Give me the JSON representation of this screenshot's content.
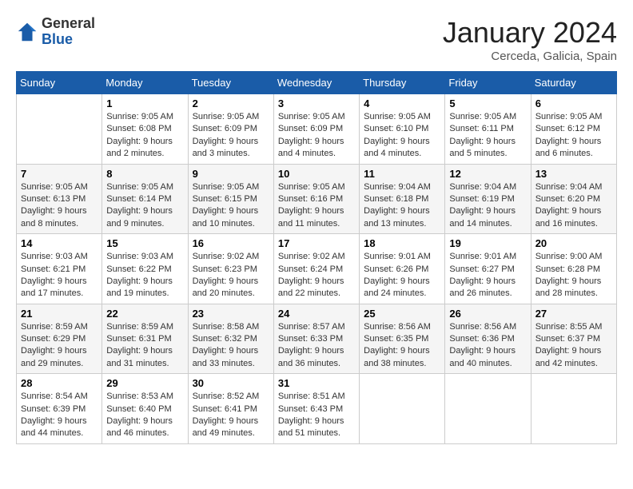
{
  "header": {
    "logo": {
      "general": "General",
      "blue": "Blue"
    },
    "title": "January 2024",
    "location": "Cerceda, Galicia, Spain"
  },
  "calendar": {
    "days_of_week": [
      "Sunday",
      "Monday",
      "Tuesday",
      "Wednesday",
      "Thursday",
      "Friday",
      "Saturday"
    ],
    "weeks": [
      [
        {
          "day": null,
          "info": null
        },
        {
          "day": "1",
          "info": "Sunrise: 9:05 AM\nSunset: 6:08 PM\nDaylight: 9 hours\nand 2 minutes."
        },
        {
          "day": "2",
          "info": "Sunrise: 9:05 AM\nSunset: 6:09 PM\nDaylight: 9 hours\nand 3 minutes."
        },
        {
          "day": "3",
          "info": "Sunrise: 9:05 AM\nSunset: 6:09 PM\nDaylight: 9 hours\nand 4 minutes."
        },
        {
          "day": "4",
          "info": "Sunrise: 9:05 AM\nSunset: 6:10 PM\nDaylight: 9 hours\nand 4 minutes."
        },
        {
          "day": "5",
          "info": "Sunrise: 9:05 AM\nSunset: 6:11 PM\nDaylight: 9 hours\nand 5 minutes."
        },
        {
          "day": "6",
          "info": "Sunrise: 9:05 AM\nSunset: 6:12 PM\nDaylight: 9 hours\nand 6 minutes."
        }
      ],
      [
        {
          "day": "7",
          "info": "Sunrise: 9:05 AM\nSunset: 6:13 PM\nDaylight: 9 hours\nand 8 minutes."
        },
        {
          "day": "8",
          "info": "Sunrise: 9:05 AM\nSunset: 6:14 PM\nDaylight: 9 hours\nand 9 minutes."
        },
        {
          "day": "9",
          "info": "Sunrise: 9:05 AM\nSunset: 6:15 PM\nDaylight: 9 hours\nand 10 minutes."
        },
        {
          "day": "10",
          "info": "Sunrise: 9:05 AM\nSunset: 6:16 PM\nDaylight: 9 hours\nand 11 minutes."
        },
        {
          "day": "11",
          "info": "Sunrise: 9:04 AM\nSunset: 6:18 PM\nDaylight: 9 hours\nand 13 minutes."
        },
        {
          "day": "12",
          "info": "Sunrise: 9:04 AM\nSunset: 6:19 PM\nDaylight: 9 hours\nand 14 minutes."
        },
        {
          "day": "13",
          "info": "Sunrise: 9:04 AM\nSunset: 6:20 PM\nDaylight: 9 hours\nand 16 minutes."
        }
      ],
      [
        {
          "day": "14",
          "info": "Sunrise: 9:03 AM\nSunset: 6:21 PM\nDaylight: 9 hours\nand 17 minutes."
        },
        {
          "day": "15",
          "info": "Sunrise: 9:03 AM\nSunset: 6:22 PM\nDaylight: 9 hours\nand 19 minutes."
        },
        {
          "day": "16",
          "info": "Sunrise: 9:02 AM\nSunset: 6:23 PM\nDaylight: 9 hours\nand 20 minutes."
        },
        {
          "day": "17",
          "info": "Sunrise: 9:02 AM\nSunset: 6:24 PM\nDaylight: 9 hours\nand 22 minutes."
        },
        {
          "day": "18",
          "info": "Sunrise: 9:01 AM\nSunset: 6:26 PM\nDaylight: 9 hours\nand 24 minutes."
        },
        {
          "day": "19",
          "info": "Sunrise: 9:01 AM\nSunset: 6:27 PM\nDaylight: 9 hours\nand 26 minutes."
        },
        {
          "day": "20",
          "info": "Sunrise: 9:00 AM\nSunset: 6:28 PM\nDaylight: 9 hours\nand 28 minutes."
        }
      ],
      [
        {
          "day": "21",
          "info": "Sunrise: 8:59 AM\nSunset: 6:29 PM\nDaylight: 9 hours\nand 29 minutes."
        },
        {
          "day": "22",
          "info": "Sunrise: 8:59 AM\nSunset: 6:31 PM\nDaylight: 9 hours\nand 31 minutes."
        },
        {
          "day": "23",
          "info": "Sunrise: 8:58 AM\nSunset: 6:32 PM\nDaylight: 9 hours\nand 33 minutes."
        },
        {
          "day": "24",
          "info": "Sunrise: 8:57 AM\nSunset: 6:33 PM\nDaylight: 9 hours\nand 36 minutes."
        },
        {
          "day": "25",
          "info": "Sunrise: 8:56 AM\nSunset: 6:35 PM\nDaylight: 9 hours\nand 38 minutes."
        },
        {
          "day": "26",
          "info": "Sunrise: 8:56 AM\nSunset: 6:36 PM\nDaylight: 9 hours\nand 40 minutes."
        },
        {
          "day": "27",
          "info": "Sunrise: 8:55 AM\nSunset: 6:37 PM\nDaylight: 9 hours\nand 42 minutes."
        }
      ],
      [
        {
          "day": "28",
          "info": "Sunrise: 8:54 AM\nSunset: 6:39 PM\nDaylight: 9 hours\nand 44 minutes."
        },
        {
          "day": "29",
          "info": "Sunrise: 8:53 AM\nSunset: 6:40 PM\nDaylight: 9 hours\nand 46 minutes."
        },
        {
          "day": "30",
          "info": "Sunrise: 8:52 AM\nSunset: 6:41 PM\nDaylight: 9 hours\nand 49 minutes."
        },
        {
          "day": "31",
          "info": "Sunrise: 8:51 AM\nSunset: 6:43 PM\nDaylight: 9 hours\nand 51 minutes."
        },
        {
          "day": null,
          "info": null
        },
        {
          "day": null,
          "info": null
        },
        {
          "day": null,
          "info": null
        }
      ]
    ]
  }
}
